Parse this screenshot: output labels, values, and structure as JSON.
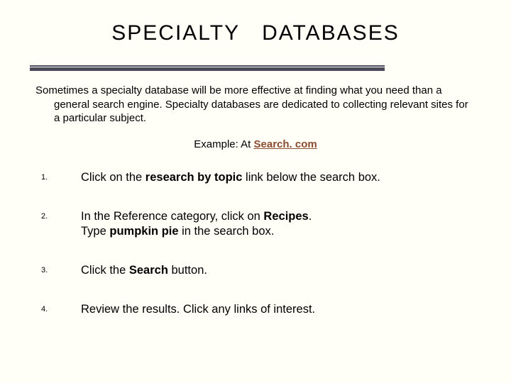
{
  "title": "SPECIALTY   DATABASES",
  "intro": "Sometimes a specialty database will be more effective at finding what you need than a general search engine. Specialty databases are dedicated to collecting relevant sites for a particular subject.",
  "example_prefix": "Example: At ",
  "example_link": "Search. com",
  "steps": [
    "Click on the <b>research by topic</b> link below the search box.",
    "In the Reference category, click on <b>Recipes</b>.<br>Type <b>pumpkin pie</b> in the search box.",
    "Click the <b>Search</b> button.",
    "Review the results. Click any links of interest."
  ]
}
